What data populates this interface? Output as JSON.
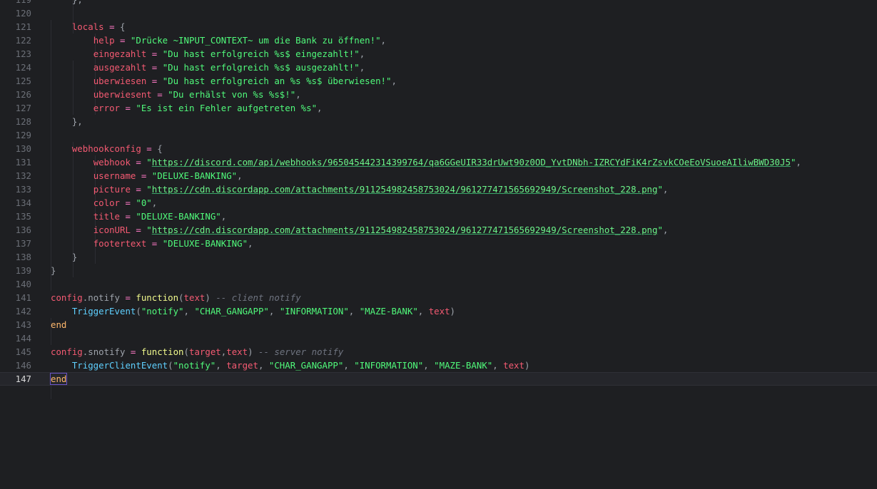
{
  "editor": {
    "lines": [
      {
        "n": "119",
        "tokens": [
          {
            "t": "    }",
            "c": "punc"
          },
          {
            "t": ",",
            "c": "punc"
          }
        ]
      },
      {
        "n": "120",
        "tokens": []
      },
      {
        "n": "121",
        "tokens": [
          {
            "t": "    "
          },
          {
            "t": "locals",
            "c": "var"
          },
          {
            "t": " = ",
            "c": "op"
          },
          {
            "t": "{",
            "c": "punc"
          }
        ]
      },
      {
        "n": "122",
        "tokens": [
          {
            "t": "        "
          },
          {
            "t": "help",
            "c": "prop"
          },
          {
            "t": " = ",
            "c": "op"
          },
          {
            "t": "\"Drücke ~INPUT_CONTEXT~ um die Bank zu öffnen!\"",
            "c": "str"
          },
          {
            "t": ",",
            "c": "punc"
          }
        ]
      },
      {
        "n": "123",
        "tokens": [
          {
            "t": "        "
          },
          {
            "t": "eingezahlt",
            "c": "prop"
          },
          {
            "t": " = ",
            "c": "op"
          },
          {
            "t": "\"Du hast erfolgreich %s$ eingezahlt!\"",
            "c": "str"
          },
          {
            "t": ",",
            "c": "punc"
          }
        ]
      },
      {
        "n": "124",
        "tokens": [
          {
            "t": "        "
          },
          {
            "t": "ausgezahlt",
            "c": "prop"
          },
          {
            "t": " = ",
            "c": "op"
          },
          {
            "t": "\"Du hast erfolgreich %s$ ausgezahlt!\"",
            "c": "str"
          },
          {
            "t": ",",
            "c": "punc"
          }
        ]
      },
      {
        "n": "125",
        "tokens": [
          {
            "t": "        "
          },
          {
            "t": "uberwiesen",
            "c": "prop"
          },
          {
            "t": " = ",
            "c": "op"
          },
          {
            "t": "\"Du hast erfolgreich an %s %s$ überwiesen!\"",
            "c": "str"
          },
          {
            "t": ",",
            "c": "punc"
          }
        ]
      },
      {
        "n": "126",
        "tokens": [
          {
            "t": "        "
          },
          {
            "t": "uberwiesent",
            "c": "prop"
          },
          {
            "t": " = ",
            "c": "op"
          },
          {
            "t": "\"Du erhälst von %s %s$!\"",
            "c": "str"
          },
          {
            "t": ",",
            "c": "punc"
          }
        ]
      },
      {
        "n": "127",
        "tokens": [
          {
            "t": "        "
          },
          {
            "t": "error",
            "c": "prop"
          },
          {
            "t": " = ",
            "c": "op"
          },
          {
            "t": "\"Es ist ein Fehler aufgetreten %s\"",
            "c": "str"
          },
          {
            "t": ",",
            "c": "punc"
          }
        ]
      },
      {
        "n": "128",
        "tokens": [
          {
            "t": "    "
          },
          {
            "t": "},",
            "c": "punc"
          }
        ]
      },
      {
        "n": "129",
        "tokens": []
      },
      {
        "n": "130",
        "tokens": [
          {
            "t": "    "
          },
          {
            "t": "webhookconfig",
            "c": "var"
          },
          {
            "t": " = ",
            "c": "op"
          },
          {
            "t": "{",
            "c": "punc"
          }
        ]
      },
      {
        "n": "131",
        "tokens": [
          {
            "t": "        "
          },
          {
            "t": "webhook",
            "c": "prop"
          },
          {
            "t": " = ",
            "c": "op"
          },
          {
            "t": "\"",
            "c": "str"
          },
          {
            "t": "https://discord.com/api/webhooks/965045442314399764/qa6GGeUIR33drUwt90z0OD_YvtDNbh-IZRCYdFiK4rZsvkCOeEoVSuoeAIliwBWD30J5",
            "c": "link"
          },
          {
            "t": "\"",
            "c": "str"
          },
          {
            "t": ",",
            "c": "punc"
          }
        ]
      },
      {
        "n": "132",
        "tokens": [
          {
            "t": "        "
          },
          {
            "t": "username",
            "c": "prop"
          },
          {
            "t": " = ",
            "c": "op"
          },
          {
            "t": "\"DELUXE-BANKING\"",
            "c": "str"
          },
          {
            "t": ",",
            "c": "punc"
          }
        ]
      },
      {
        "n": "133",
        "tokens": [
          {
            "t": "        "
          },
          {
            "t": "picture",
            "c": "prop"
          },
          {
            "t": " = ",
            "c": "op"
          },
          {
            "t": "\"",
            "c": "str"
          },
          {
            "t": "https://cdn.discordapp.com/attachments/911254982458753024/961277471565692949/Screenshot_228.png",
            "c": "link"
          },
          {
            "t": "\"",
            "c": "str"
          },
          {
            "t": ",",
            "c": "punc"
          }
        ]
      },
      {
        "n": "134",
        "tokens": [
          {
            "t": "        "
          },
          {
            "t": "color",
            "c": "prop"
          },
          {
            "t": " = ",
            "c": "op"
          },
          {
            "t": "\"0\"",
            "c": "str"
          },
          {
            "t": ",",
            "c": "punc"
          }
        ]
      },
      {
        "n": "135",
        "tokens": [
          {
            "t": "        "
          },
          {
            "t": "title",
            "c": "prop"
          },
          {
            "t": " = ",
            "c": "op"
          },
          {
            "t": "\"DELUXE-BANKING\"",
            "c": "str"
          },
          {
            "t": ",",
            "c": "punc"
          }
        ]
      },
      {
        "n": "136",
        "tokens": [
          {
            "t": "        "
          },
          {
            "t": "iconURL",
            "c": "prop"
          },
          {
            "t": " = ",
            "c": "op"
          },
          {
            "t": "\"",
            "c": "str"
          },
          {
            "t": "https://cdn.discordapp.com/attachments/911254982458753024/961277471565692949/Screenshot_228.png",
            "c": "link"
          },
          {
            "t": "\"",
            "c": "str"
          },
          {
            "t": ",",
            "c": "punc"
          }
        ]
      },
      {
        "n": "137",
        "tokens": [
          {
            "t": "        "
          },
          {
            "t": "footertext",
            "c": "prop"
          },
          {
            "t": " = ",
            "c": "op"
          },
          {
            "t": "\"DELUXE-BANKING\"",
            "c": "str"
          },
          {
            "t": ",",
            "c": "punc"
          }
        ]
      },
      {
        "n": "138",
        "tokens": [
          {
            "t": "    "
          },
          {
            "t": "}",
            "c": "punc"
          }
        ]
      },
      {
        "n": "139",
        "tokens": [
          {
            "t": "}",
            "c": "punc"
          }
        ]
      },
      {
        "n": "140",
        "tokens": []
      },
      {
        "n": "141",
        "tokens": [
          {
            "t": "config",
            "c": "var"
          },
          {
            "t": ".",
            "c": "dot"
          },
          {
            "t": "notify",
            "c": "dot"
          },
          {
            "t": " = ",
            "c": "op"
          },
          {
            "t": "function",
            "c": "fn"
          },
          {
            "t": "(",
            "c": "punc"
          },
          {
            "t": "text",
            "c": "var"
          },
          {
            "t": ")",
            "c": "punc"
          },
          {
            "t": " -- client notify",
            "c": "cmt"
          }
        ]
      },
      {
        "n": "142",
        "tokens": [
          {
            "t": "    "
          },
          {
            "t": "TriggerEvent",
            "c": "call"
          },
          {
            "t": "(",
            "c": "punc"
          },
          {
            "t": "\"notify\"",
            "c": "str"
          },
          {
            "t": ", ",
            "c": "punc"
          },
          {
            "t": "\"CHAR_GANGAPP\"",
            "c": "str"
          },
          {
            "t": ", ",
            "c": "punc"
          },
          {
            "t": "\"INFORMATION\"",
            "c": "str"
          },
          {
            "t": ", ",
            "c": "punc"
          },
          {
            "t": "\"MAZE-BANK\"",
            "c": "str"
          },
          {
            "t": ", ",
            "c": "punc"
          },
          {
            "t": "text",
            "c": "var"
          },
          {
            "t": ")",
            "c": "punc"
          }
        ]
      },
      {
        "n": "143",
        "tokens": [
          {
            "t": "end",
            "c": "kw"
          }
        ]
      },
      {
        "n": "144",
        "tokens": []
      },
      {
        "n": "145",
        "tokens": [
          {
            "t": "config",
            "c": "var"
          },
          {
            "t": ".",
            "c": "dot"
          },
          {
            "t": "snotify",
            "c": "dot"
          },
          {
            "t": " = ",
            "c": "op"
          },
          {
            "t": "function",
            "c": "fn"
          },
          {
            "t": "(",
            "c": "punc"
          },
          {
            "t": "target",
            "c": "var"
          },
          {
            "t": ",",
            "c": "punc"
          },
          {
            "t": "text",
            "c": "var"
          },
          {
            "t": ")",
            "c": "punc"
          },
          {
            "t": " -- server notify",
            "c": "cmt"
          }
        ]
      },
      {
        "n": "146",
        "tokens": [
          {
            "t": "    "
          },
          {
            "t": "TriggerClientEvent",
            "c": "call"
          },
          {
            "t": "(",
            "c": "punc"
          },
          {
            "t": "\"notify\"",
            "c": "str"
          },
          {
            "t": ", ",
            "c": "punc"
          },
          {
            "t": "target",
            "c": "var"
          },
          {
            "t": ", ",
            "c": "punc"
          },
          {
            "t": "\"CHAR_GANGAPP\"",
            "c": "str"
          },
          {
            "t": ", ",
            "c": "punc"
          },
          {
            "t": "\"INFORMATION\"",
            "c": "str"
          },
          {
            "t": ", ",
            "c": "punc"
          },
          {
            "t": "\"MAZE-BANK\"",
            "c": "str"
          },
          {
            "t": ", ",
            "c": "punc"
          },
          {
            "t": "text",
            "c": "var"
          },
          {
            "t": ")",
            "c": "punc"
          }
        ]
      },
      {
        "n": "147",
        "tokens": [
          {
            "t": "end",
            "c": "kw",
            "box": true
          }
        ],
        "current": true
      }
    ]
  }
}
